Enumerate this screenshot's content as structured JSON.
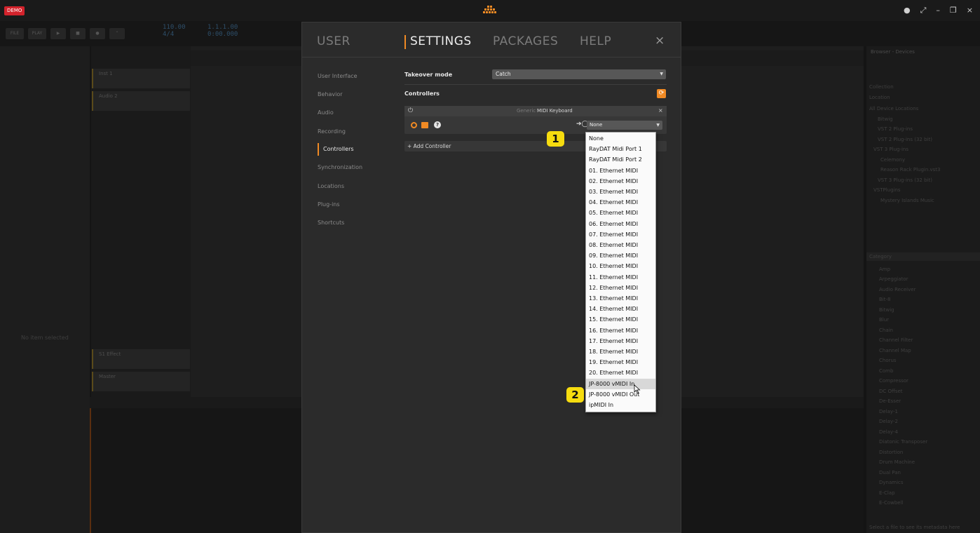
{
  "app": {
    "demo_badge": "DEMO",
    "no_item_selected": "No item selected",
    "window_controls": [
      "●",
      "⤢",
      "–",
      "❐",
      "×"
    ]
  },
  "transport": {
    "buttons": [
      "FILE",
      "PLAY",
      "▶",
      "■",
      "●",
      "⌃"
    ],
    "bpm": "110.00",
    "time_sig": "4/4",
    "position": "1.1.1.00",
    "time": "0:00.000"
  },
  "tracks": [
    {
      "name": "Inst 1"
    },
    {
      "name": "Audio 2"
    },
    {
      "name": "S1 Effect"
    },
    {
      "name": "Master"
    }
  ],
  "browser": {
    "title": "Browser - Devices",
    "sections": [
      "Collection",
      "Location",
      "All Device Locations",
      "Bitwig",
      "VST 2 Plug-ins",
      "VST 2 Plug-ins (32 bit)",
      "VST 3 Plug-ins",
      "Celemony",
      "Reason Rack Plugin.vst3",
      "VST 3 Plug-ins (32 bit)",
      "VSTPlugins",
      "Mystery Islands Music"
    ],
    "category_header": "Category",
    "categories": [
      "Amp",
      "Arpeggiator",
      "Audio Receiver",
      "Bit-8",
      "Bitwig",
      "Blur",
      "Chain",
      "Channel Filter",
      "Channel Map",
      "Chorus",
      "Comb",
      "Compressor",
      "DC Offset",
      "De-Esser",
      "Delay-1",
      "Delay-2",
      "Delay-4",
      "Diatonic Transposer",
      "Distortion",
      "Drum Machine",
      "Dual Pan",
      "Dynamics",
      "E-Clap",
      "E-Cowbell"
    ],
    "footer": "Select a file to see its metadata here"
  },
  "settings": {
    "tabs": {
      "user": "USER",
      "settings": "SETTINGS",
      "packages": "PACKAGES",
      "help": "HELP",
      "close": "×"
    },
    "nav": [
      {
        "label": "User Interface",
        "active": false
      },
      {
        "label": "Behavior",
        "active": false
      },
      {
        "label": "Audio",
        "active": false
      },
      {
        "label": "Recording",
        "active": false
      },
      {
        "label": "Controllers",
        "active": true
      },
      {
        "label": "Synchronization",
        "active": false
      },
      {
        "label": "Locations",
        "active": false
      },
      {
        "label": "Plug-ins",
        "active": false
      },
      {
        "label": "Shortcuts",
        "active": false
      }
    ],
    "takeover_label": "Takeover mode",
    "takeover_value": "Catch",
    "controllers_label": "Controllers",
    "controller": {
      "kind": "Generic",
      "name": "MIDI Keyboard",
      "port_value": "None",
      "remove": "×"
    },
    "add_controller": "+ Add Controller"
  },
  "midi_ports": {
    "items": [
      "None",
      "RayDAT Midi Port 1",
      "RayDAT Midi Port 2",
      "01. Ethernet MIDI",
      "02. Ethernet MIDI",
      "03. Ethernet MIDI",
      "04. Ethernet MIDI",
      "05. Ethernet MIDI",
      "06. Ethernet MIDI",
      "07. Ethernet MIDI",
      "08. Ethernet MIDI",
      "09. Ethernet MIDI",
      "10. Ethernet MIDI",
      "11. Ethernet MIDI",
      "12. Ethernet MIDI",
      "13. Ethernet MIDI",
      "14. Ethernet MIDI",
      "15. Ethernet MIDI",
      "16. Ethernet MIDI",
      "17. Ethernet MIDI",
      "18. Ethernet MIDI",
      "19. Ethernet MIDI",
      "20. Ethernet MIDI",
      "JP-8000 vMIDI In",
      "JP-8000 vMIDI Out",
      "ipMIDI In"
    ],
    "hovered": "JP-8000 vMIDI In"
  },
  "callouts": [
    "1",
    "2"
  ],
  "colors": {
    "accent": "#f08a24",
    "callout": "#f6dc0f",
    "demo": "#d3232c"
  }
}
